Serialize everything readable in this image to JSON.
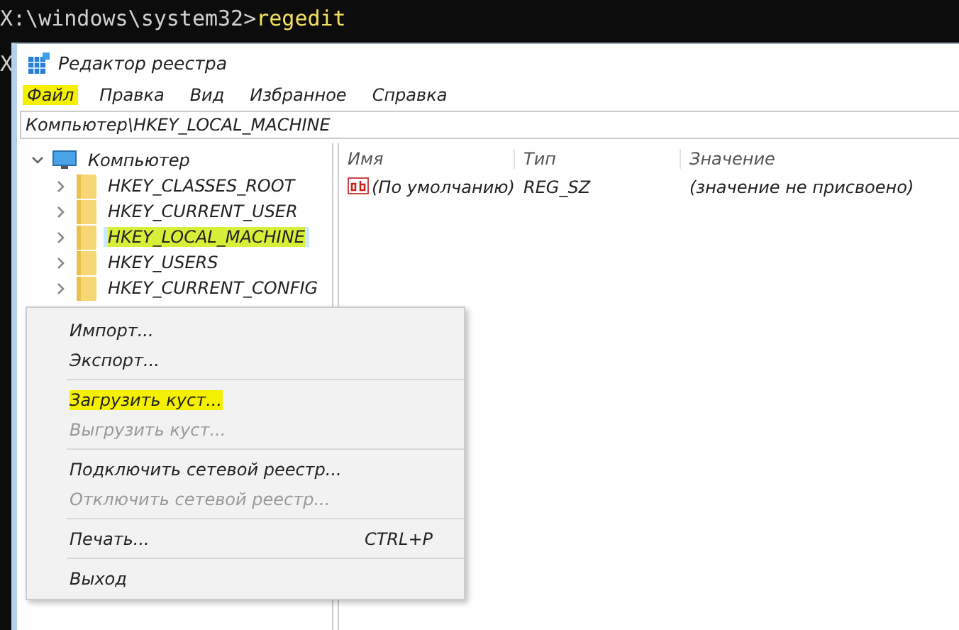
{
  "console": {
    "lines": [
      {
        "prompt": "X:\\windows\\system32>",
        "command": "regedit"
      },
      {
        "prompt": "X"
      }
    ]
  },
  "window": {
    "title": "Редактор реестра"
  },
  "menu_bar": [
    {
      "label": "Файл",
      "highlighted": true
    },
    {
      "label": "Правка",
      "highlighted": false
    },
    {
      "label": "Вид",
      "highlighted": false
    },
    {
      "label": "Избранное",
      "highlighted": false
    },
    {
      "label": "Справка",
      "highlighted": false
    }
  ],
  "address_bar": {
    "value": "Компьютер\\HKEY_LOCAL_MACHINE"
  },
  "tree": [
    {
      "label": "Компьютер",
      "kind": "computer",
      "expanded": true,
      "selected": false,
      "highlighted": false,
      "children": [
        {
          "label": "HKEY_CLASSES_ROOT",
          "kind": "folder",
          "expanded": false,
          "selected": false,
          "highlighted": false
        },
        {
          "label": "HKEY_CURRENT_USER",
          "kind": "folder",
          "expanded": false,
          "selected": false,
          "highlighted": false
        },
        {
          "label": "HKEY_LOCAL_MACHINE",
          "kind": "folder",
          "expanded": false,
          "selected": true,
          "highlighted": true
        },
        {
          "label": "HKEY_USERS",
          "kind": "folder",
          "expanded": false,
          "selected": false,
          "highlighted": false
        },
        {
          "label": "HKEY_CURRENT_CONFIG",
          "kind": "folder",
          "expanded": false,
          "selected": false,
          "highlighted": false
        }
      ]
    }
  ],
  "values_table": {
    "columns": [
      "Имя",
      "Тип",
      "Значение"
    ],
    "rows": [
      {
        "name": "(По умолчанию)",
        "type": "REG_SZ",
        "data": "(значение не присвоено)"
      }
    ]
  },
  "file_menu": [
    {
      "kind": "item",
      "label": "Импорт...",
      "disabled": false,
      "highlighted": false
    },
    {
      "kind": "item",
      "label": "Экспорт...",
      "disabled": false,
      "highlighted": false
    },
    {
      "kind": "separator"
    },
    {
      "kind": "item",
      "label": "Загрузить куст...",
      "disabled": false,
      "highlighted": true
    },
    {
      "kind": "item",
      "label": "Выгрузить куст...",
      "disabled": true,
      "highlighted": false
    },
    {
      "kind": "separator"
    },
    {
      "kind": "item",
      "label": "Подключить сетевой реестр...",
      "disabled": false,
      "highlighted": false
    },
    {
      "kind": "item",
      "label": "Отключить сетевой реестр...",
      "disabled": true,
      "highlighted": false
    },
    {
      "kind": "separator"
    },
    {
      "kind": "item",
      "label": "Печать...",
      "shortcut": "CTRL+P",
      "disabled": false,
      "highlighted": false
    },
    {
      "kind": "separator"
    },
    {
      "kind": "item",
      "label": "Выход",
      "disabled": false,
      "highlighted": false
    }
  ]
}
